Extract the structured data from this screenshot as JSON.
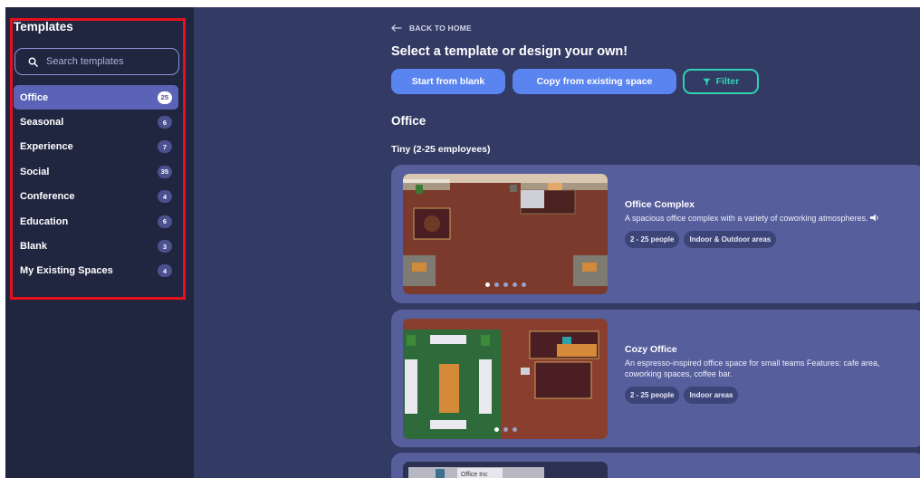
{
  "sidebar": {
    "title": "Templates",
    "search_placeholder": "Search templates",
    "categories": [
      {
        "label": "Office",
        "count": "25",
        "active": true
      },
      {
        "label": "Seasonal",
        "count": "6"
      },
      {
        "label": "Experience",
        "count": "7"
      },
      {
        "label": "Social",
        "count": "35"
      },
      {
        "label": "Conference",
        "count": "4"
      },
      {
        "label": "Education",
        "count": "6"
      },
      {
        "label": "Blank",
        "count": "3"
      },
      {
        "label": "My Existing Spaces",
        "count": "4"
      }
    ]
  },
  "main": {
    "back_label": "BACK TO HOME",
    "heading": "Select a template or design your own!",
    "buttons": {
      "start_blank": "Start from blank",
      "copy_existing": "Copy from existing space",
      "filter": "Filter"
    },
    "section_title": "Office",
    "subsection_title": "Tiny (2-25 employees)",
    "cards": [
      {
        "title": "Office Complex",
        "description": "A spacious office complex with a variety of coworking atmospheres.",
        "tags": [
          "2 - 25 people",
          "Indoor & Outdoor areas"
        ],
        "slides": 5,
        "active_slide": 1
      },
      {
        "title": "Cozy Office",
        "description": "An espresso-inspired office space for small teams Features: cafe area, coworking spaces, coffee bar.",
        "tags": [
          "2 - 25 people",
          "Indoor areas"
        ],
        "slides": 3,
        "active_slide": 1
      },
      {
        "thumbnail_sign": "Office Inc"
      }
    ]
  },
  "colors": {
    "sidebar_bg": "#202540",
    "main_bg": "#333a64",
    "card_bg": "#565e9c",
    "primary_button": "#5a84ef",
    "filter_accent": "#2ed3b3",
    "highlight": "#e8101c"
  },
  "icons": {
    "search": "search-icon",
    "back": "arrow-left-icon",
    "filter": "filter-icon",
    "sound": "speaker-icon"
  }
}
